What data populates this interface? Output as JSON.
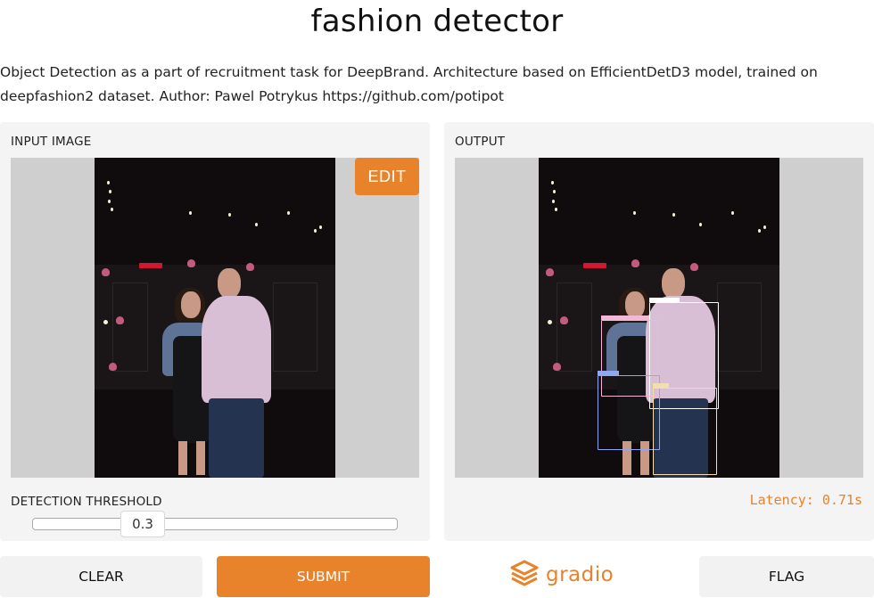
{
  "page": {
    "title": "fashion detector",
    "description": "Object Detection as a part of recruitment task for DeepBrand. Architecture based on EfficientDetD3 model, trained on deepfashion2 dataset. Author: Pawel Potrykus https://github.com/potipot"
  },
  "input": {
    "label": "INPUT IMAGE",
    "edit_label": "EDIT",
    "threshold_label": "DETECTION THRESHOLD",
    "threshold_value": "0.3",
    "threshold_fraction": 0.3
  },
  "output": {
    "label": "OUTPUT",
    "latency": "Latency: 0.71s"
  },
  "actions": {
    "clear_label": "CLEAR",
    "submit_label": "SUBMIT",
    "flag_label": "FLAG"
  },
  "branding": {
    "logo_text": "gradio"
  },
  "colors": {
    "accent": "#e8822b",
    "panel": "#f4f4f4",
    "image_bg": "#cfcfcf",
    "box_white": "#ffffff",
    "box_pink": "#f3b8d6",
    "box_blue": "#8fa8f0",
    "box_yellow": "#f3deb0"
  }
}
